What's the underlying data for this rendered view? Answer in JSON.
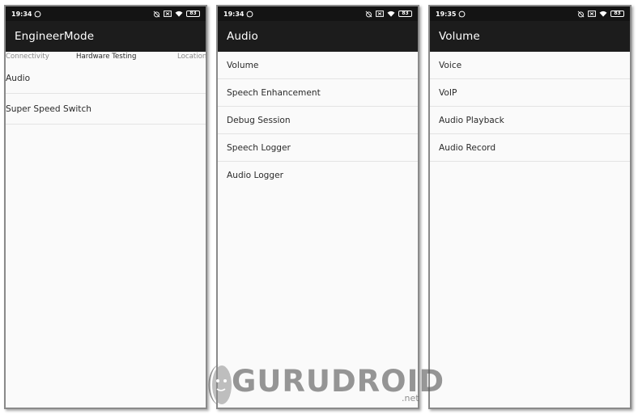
{
  "screens": [
    {
      "status": {
        "time": "19:34",
        "battery": "83"
      },
      "title": "EngineerMode",
      "tabs": [
        "Connectivity",
        "Hardware Testing",
        "Location"
      ],
      "items": [
        "Audio",
        "Super Speed Switch"
      ]
    },
    {
      "status": {
        "time": "19:34",
        "battery": "83"
      },
      "title": "Audio",
      "items": [
        "Volume",
        "Speech Enhancement",
        "Debug Session",
        "Speech Logger",
        "Audio Logger"
      ]
    },
    {
      "status": {
        "time": "19:35",
        "battery": "83"
      },
      "title": "Volume",
      "items": [
        "Voice",
        "VoIP",
        "Audio Playback",
        "Audio Record"
      ]
    }
  ],
  "status_icons": [
    "whatsapp-icon",
    "alarm-off-icon",
    "screen-cast-icon",
    "wifi-icon",
    "battery-icon"
  ],
  "watermark": {
    "text": "GURUDROID",
    "suffix": ".net"
  },
  "colors": {
    "appbar": "#1c1c1c",
    "statusbar": "#141414",
    "background": "#fafafa",
    "divider": "#e3e3e3"
  }
}
